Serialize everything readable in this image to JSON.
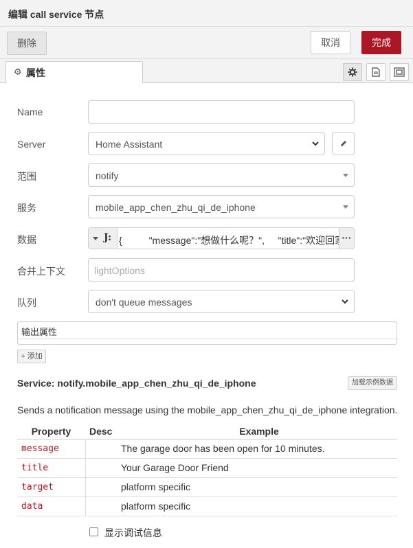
{
  "header": {
    "title": "编辑 call service 节点"
  },
  "toolbar": {
    "delete_label": "删除",
    "cancel_label": "取消",
    "done_label": "完成"
  },
  "tabs": {
    "active_label": "属性",
    "active_icon": "gear-icon"
  },
  "side_icons": [
    "gear-icon",
    "document-icon",
    "frame-icon"
  ],
  "form": {
    "name": {
      "label": "Name",
      "value": ""
    },
    "server": {
      "label": "Server",
      "value": "Home Assistant"
    },
    "domain": {
      "label": "范围",
      "value": "notify"
    },
    "service": {
      "label": "服务",
      "value": "mobile_app_chen_zhu_qi_de_iphone"
    },
    "data": {
      "label": "数据",
      "value": "{          \"message\":\"想做什么呢？\",     \"title\":\"欢迎回家"
    },
    "merge_context": {
      "label": "合并上下文",
      "placeholder": "lightOptions"
    },
    "queue": {
      "label": "队列",
      "value": "don't queue messages"
    }
  },
  "output": {
    "title": "输出属性",
    "add_label": "+ 添加"
  },
  "service_info": {
    "title": "Service: notify.mobile_app_chen_zhu_qi_de_iphone",
    "load_label": "加载示例数据",
    "description": "Sends a notification message using the mobile_app_chen_zhu_qi_de_iphone integration.",
    "columns": [
      "Property",
      "Desc",
      "Example"
    ],
    "rows": [
      {
        "property": "message",
        "desc": "",
        "example": "The garage door has been open for 10 minutes."
      },
      {
        "property": "title",
        "desc": "",
        "example": "Your Garage Door Friend"
      },
      {
        "property": "target",
        "desc": "",
        "example": "platform specific"
      },
      {
        "property": "data",
        "desc": "",
        "example": "platform specific"
      }
    ]
  },
  "debug": {
    "label": "显示调试信息",
    "checked": false
  },
  "colors": {
    "primary": "#ad1625",
    "border": "#cccccc",
    "panel": "#f3f3f3"
  }
}
